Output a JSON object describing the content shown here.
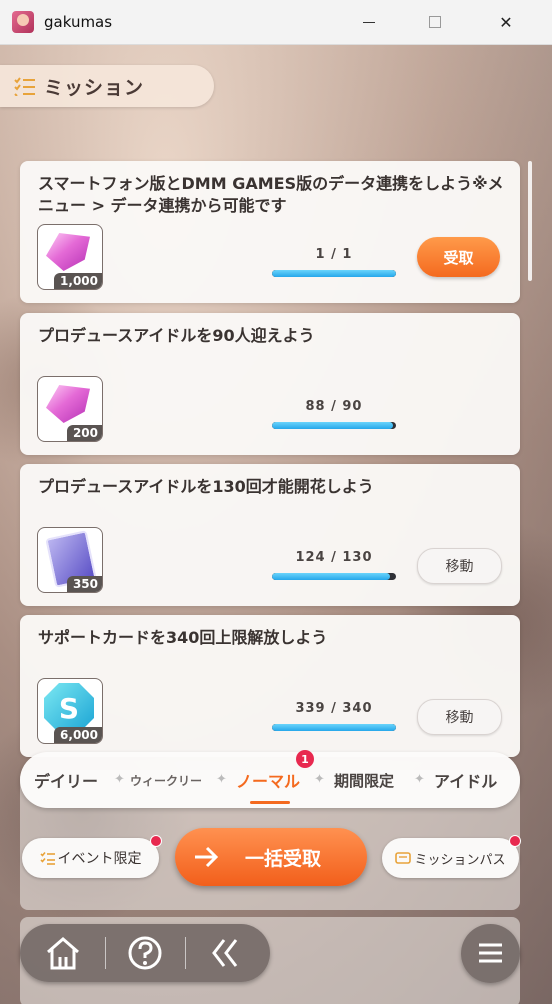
{
  "window": {
    "app_title": "gakumas",
    "icon": "app-icon",
    "controls": [
      "minimize-icon",
      "maximize-icon",
      "close-icon"
    ],
    "close_glyph": "✕"
  },
  "header": {
    "title": "ミッション",
    "icon": "checklist-icon"
  },
  "missions": [
    {
      "text": "スマートフォン版とDMM GAMES版のデータ連携をしよう※メニュー > データ連携から可能です",
      "reward_icon": "pink-gem-icon",
      "reward_qty": "1,000",
      "progress_text": "1 / 1",
      "progress": 1.0,
      "button": "受取",
      "button_type": "claim"
    },
    {
      "text": "プロデュースアイドルを90人迎えよう",
      "reward_icon": "pink-gem-icon",
      "reward_qty": "200",
      "progress_text": "88 / 90",
      "progress": 0.978,
      "button": "",
      "button_type": "none"
    },
    {
      "text": "プロデュースアイドルを130回才能開花しよう",
      "reward_icon": "card-item-icon",
      "reward_qty": "350",
      "progress_text": "124 / 130",
      "progress": 0.954,
      "button": "移動",
      "button_type": "move"
    },
    {
      "text": "サポートカードを340回上限解放しよう",
      "reward_icon": "support-s-icon",
      "reward_qty": "6,000",
      "progress_text": "339 / 340",
      "progress": 0.997,
      "button": "移動",
      "button_type": "move"
    }
  ],
  "tabs": {
    "daily": "デイリー",
    "weekly": "ウィークリー",
    "normal": "ノーマル",
    "period": "期間限定",
    "idol": "アイドル",
    "active": "normal",
    "normal_badge": "1",
    "separator": "✦"
  },
  "actions": {
    "event_label": "イベント限定",
    "bulk_label": "一括受取",
    "pass_label": "ミッションパス",
    "s_letter": "S"
  },
  "bottom_nav": [
    "home-icon",
    "help-icon",
    "back-icon",
    "menu-icon"
  ],
  "colors": {
    "accent": "#f46a1f",
    "progress": "#26a7ea",
    "badge": "#e8294f"
  }
}
